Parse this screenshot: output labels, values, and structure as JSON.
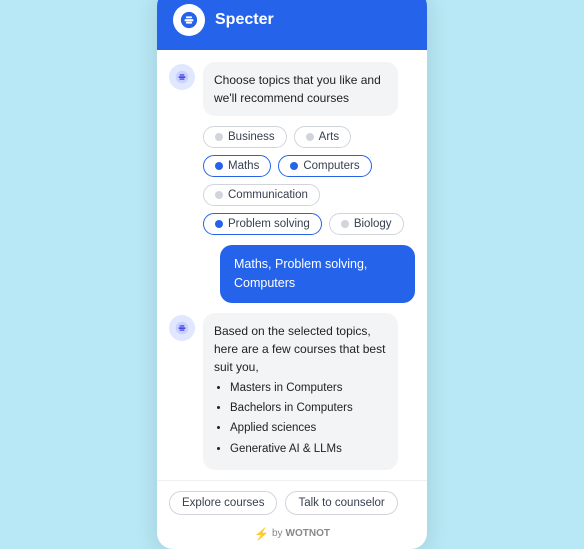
{
  "header": {
    "title": "Specter"
  },
  "bot_message_1": {
    "text": "Choose topics that you like and we'll recommend courses"
  },
  "topics": [
    {
      "id": "business",
      "label": "Business",
      "selected": false
    },
    {
      "id": "arts",
      "label": "Arts",
      "selected": false
    },
    {
      "id": "maths",
      "label": "Maths",
      "selected": true
    },
    {
      "id": "computers",
      "label": "Computers",
      "selected": true
    },
    {
      "id": "communication",
      "label": "Communication",
      "selected": false
    },
    {
      "id": "problem-solving",
      "label": "Problem solving",
      "selected": true
    },
    {
      "id": "biology",
      "label": "Biology",
      "selected": false
    }
  ],
  "user_response": {
    "text": "Maths, Problem solving, Computers"
  },
  "bot_message_2": {
    "intro": "Based on the selected topics, here are a few courses that best suit you,",
    "courses": [
      "Masters in Computers",
      "Bachelors in Computers",
      "Applied sciences",
      "Generative AI & LLMs"
    ]
  },
  "action_buttons": [
    {
      "id": "explore",
      "label": "Explore courses"
    },
    {
      "id": "counselor",
      "label": "Talk to counselor"
    }
  ],
  "footer": {
    "prefix": "by",
    "brand": "WOTNOT"
  }
}
